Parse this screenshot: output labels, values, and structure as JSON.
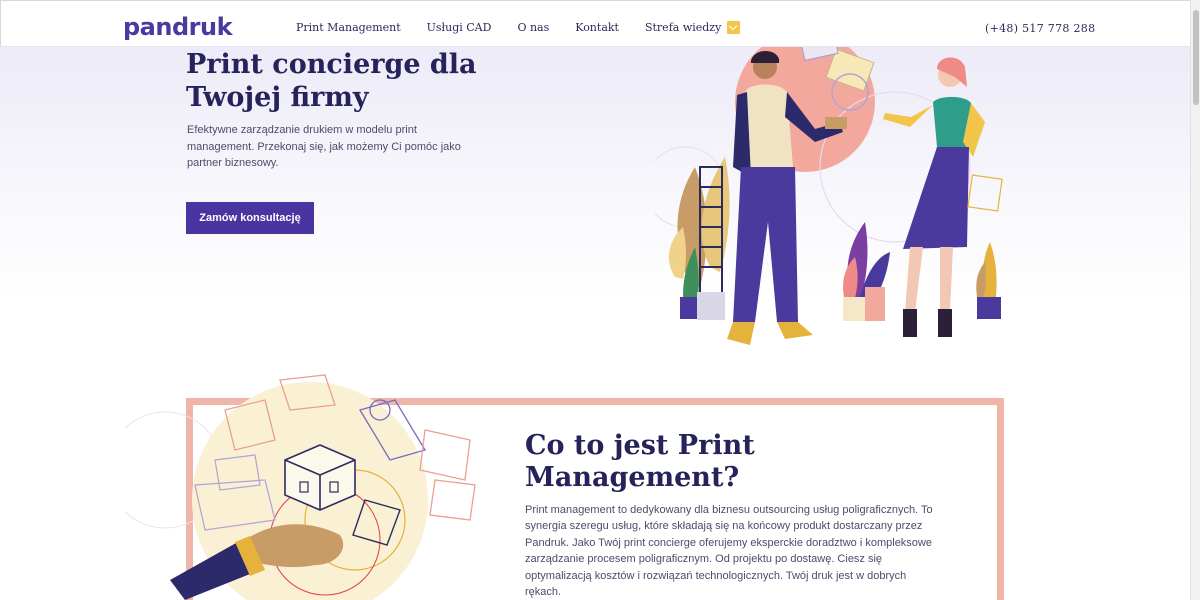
{
  "brand": {
    "logo_text": "pandruk",
    "accent": "#4a35a0",
    "yellow": "#f2c64a",
    "frame_color": "#efb5a8"
  },
  "nav": {
    "items": [
      {
        "label": "Print Management"
      },
      {
        "label": "Usługi CAD"
      },
      {
        "label": "O nas"
      },
      {
        "label": "Kontakt"
      },
      {
        "label": "Strefa wiedzy",
        "icon": "chevron-down-icon"
      }
    ],
    "phone": "(+48) 517 778 288"
  },
  "hero": {
    "title": "Print concierge dla Twojej firmy",
    "text": "Efektywne zarządzanie drukiem w modelu print management. Przekonaj się, jak możemy Ci pomóc jako partner biznesowy.",
    "cta_label": "Zamów konsultację"
  },
  "section2": {
    "title": "Co to jest Print Management?",
    "text": "Print management to dedykowany dla biznesu outsourcing usług poligraficznych. To synergia szeregu usług, które składają się na końcowy produkt dostarczany przez Pandruk. Jako Twój print concierge oferujemy eksperckie doradztwo i kompleksowe zarządzanie procesem poligraficznym. Od projektu po dostawę. Ciesz się optymalizacją kosztów i rozwiązań technologicznych. Twój druk jest w dobrych rękach."
  }
}
